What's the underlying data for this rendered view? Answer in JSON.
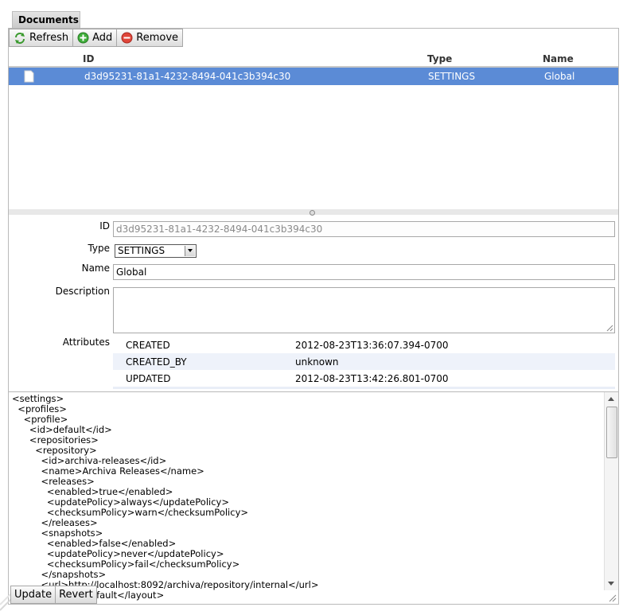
{
  "tab": {
    "label": "Documents"
  },
  "toolbar": {
    "refresh": "Refresh",
    "add": "Add",
    "remove": "Remove"
  },
  "grid": {
    "headers": {
      "id": "ID",
      "type": "Type",
      "name": "Name"
    },
    "rows": [
      {
        "id": "d3d95231-81a1-4232-8494-041c3b394c30",
        "type": "SETTINGS",
        "name": "Global"
      }
    ]
  },
  "form": {
    "id_label": "ID",
    "id_value": "d3d95231-81a1-4232-8494-041c3b394c30",
    "type_label": "Type",
    "type_value": "SETTINGS",
    "name_label": "Name",
    "name_value": "Global",
    "description_label": "Description",
    "description_value": "",
    "attributes_label": "Attributes",
    "attributes": [
      {
        "key": "CREATED",
        "value": "2012-08-23T13:36:07.394-0700"
      },
      {
        "key": "CREATED_BY",
        "value": "unknown"
      },
      {
        "key": "UPDATED",
        "value": "2012-08-23T13:42:26.801-0700"
      }
    ]
  },
  "code": {
    "lines": [
      "<settings>",
      "  <profiles>",
      "    <profile>",
      "      <id>default</id>",
      "      <repositories>",
      "        <repository>",
      "          <id>archiva-releases</id>",
      "          <name>Archiva Releases</name>",
      "          <releases>",
      "            <enabled>true</enabled>",
      "            <updatePolicy>always</updatePolicy>",
      "            <checksumPolicy>warn</checksumPolicy>",
      "          </releases>",
      "          <snapshots>",
      "            <enabled>false</enabled>",
      "            <updatePolicy>never</updatePolicy>",
      "            <checksumPolicy>fail</checksumPolicy>",
      "          </snapshots>",
      "          <url>http://localhost:8092/archiva/repository/internal</url>",
      "          <layout>default</layout>"
    ]
  },
  "footer": {
    "update": "Update",
    "revert": "Revert"
  },
  "colors": {
    "selection": "#5b8bd6",
    "attr_alt_row": "#eef2fa"
  }
}
